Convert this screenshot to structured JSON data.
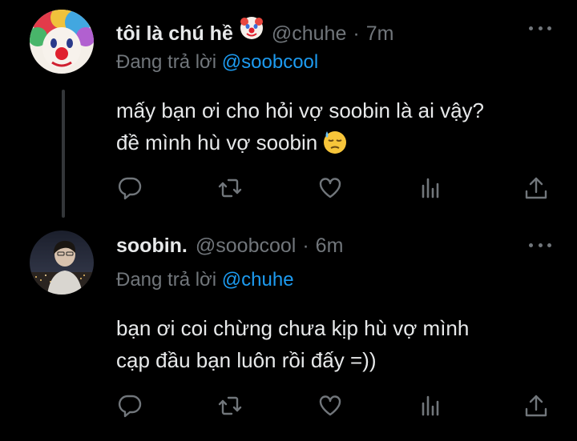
{
  "colors": {
    "background": "#000000",
    "text_primary": "#e7e9ea",
    "text_secondary": "#71767b",
    "mention": "#1d9bf0",
    "thread_line": "#333639"
  },
  "tweets": [
    {
      "display_name": "tôi là chú hề",
      "name_emoji": "clown-face-icon",
      "handle": "@chuhe",
      "separator": "·",
      "time": "7m",
      "reply_prefix": "Đang trả lời",
      "reply_to": "@soobcool",
      "text_line1": "mấy bạn ơi cho hỏi vợ soobin là ai vậy?",
      "text_line2": "đề mình hù vợ soobin",
      "text_emoji": "downcast-face-with-sweat-icon"
    },
    {
      "display_name": "soobin.",
      "handle": "@soobcool",
      "separator": "·",
      "time": "6m",
      "reply_prefix": "Đang trả lời",
      "reply_to": "@chuhe",
      "text_line1": "bạn ơi coi chừng chưa kịp hù vợ mình",
      "text_line2": "cạp đầu bạn luôn rồi đấy =))"
    }
  ],
  "action_icons": [
    "reply-icon",
    "retweet-icon",
    "like-icon",
    "views-icon",
    "share-icon"
  ]
}
